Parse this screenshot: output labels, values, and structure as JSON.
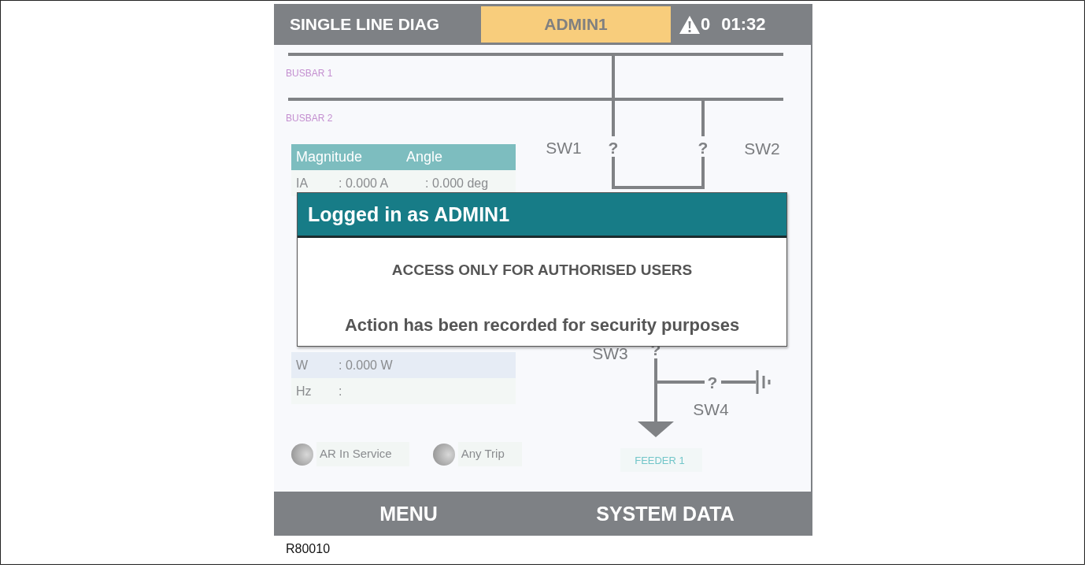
{
  "header": {
    "title": "SINGLE LINE DIAG",
    "user": "ADMIN1",
    "alarm_count": "0",
    "time": "01:32"
  },
  "diagram": {
    "busbars": [
      "BUSBAR 1",
      "BUSBAR 2"
    ],
    "switches": [
      {
        "label": "SW1",
        "state": "?"
      },
      {
        "label": "SW2",
        "state": "?"
      },
      {
        "label": "SW3",
        "state": "?"
      },
      {
        "label": "SW4",
        "state": "?"
      }
    ],
    "feeder": "FEEDER 1"
  },
  "measurements": {
    "columns": [
      "Magnitude",
      "Angle"
    ],
    "rows": [
      {
        "name": "IA",
        "magnitude": ": 0.000 A",
        "angle": ": 0.000 deg"
      },
      {
        "name": "W",
        "magnitude": ": 0.000 W"
      },
      {
        "name": "Hz",
        "magnitude": ":"
      }
    ]
  },
  "indicators": [
    {
      "label": "AR In Service",
      "on": false
    },
    {
      "label": "Any Trip",
      "on": false
    }
  ],
  "dialog": {
    "title": "Logged in as ADMIN1",
    "message": "ACCESS ONLY FOR AUTHORISED USERS",
    "note": "Action has been recorded for security purposes"
  },
  "footer": {
    "buttons": [
      "MENU",
      "SYSTEM DATA"
    ]
  },
  "figure_id": "R80010"
}
